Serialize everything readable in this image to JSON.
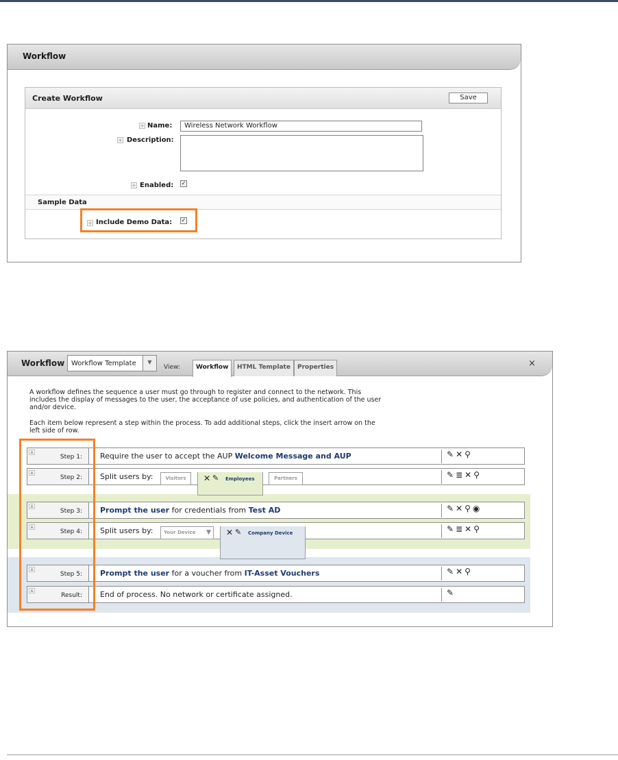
{
  "panel1": {
    "title": "Workflow",
    "form_title": "Create Workflow",
    "save_label": "Save",
    "name_label": "Name:",
    "name_value": "Wireless Network Workflow",
    "description_label": "Description:",
    "enabled_label": "Enabled:",
    "enabled_checked": true,
    "section_label": "Sample Data",
    "demo_label": "Include Demo Data:",
    "demo_checked": true,
    "highlight_color": "#f58025"
  },
  "panel2": {
    "title": "Workflow",
    "template_select": "Workflow Template",
    "view_label": "View:",
    "tabs": [
      "Workflow",
      "HTML Template",
      "Properties"
    ],
    "active_tab": "Workflow",
    "close_label": "×",
    "desc_para1_lines": [
      "A workflow defines the sequence a user must go through to register and connect to the network. This",
      "includes the display of messages to the user, the acceptance of use policies, and authentication of the user",
      "and/or device."
    ],
    "desc_para2_lines": [
      "Each item below represent a step within the process. To add additional steps, click the insert arrow on the",
      "left side of row."
    ],
    "steps": [
      {
        "label": "Step 1:",
        "pre": "Require the user to accept the AUP ",
        "bold": "Welcome Message and AUP",
        "post": "",
        "actions": [
          "edit-icon",
          "delete-icon",
          "search-icon"
        ]
      },
      {
        "label": "Step 2:",
        "pre": "Split users by:",
        "segments": [
          "Visitors",
          "Employees",
          "Partners"
        ],
        "active_segment": "Employees",
        "actions": [
          "edit-icon",
          "list-icon",
          "delete-icon",
          "search-icon"
        ]
      },
      {
        "label": "Step 3:",
        "bold1": "Prompt the user",
        "mid": " for credentials from ",
        "bold2": "Test AD",
        "actions": [
          "edit-icon",
          "delete-icon",
          "search-icon",
          "play-icon"
        ]
      },
      {
        "label": "Step 4:",
        "pre": "Split users by:",
        "segments": [
          "Your Device",
          "Company Device"
        ],
        "active_segment": "Company Device",
        "actions": [
          "edit-icon",
          "list-icon",
          "delete-icon",
          "search-icon"
        ]
      },
      {
        "label": "Step 5:",
        "bold1": "Prompt the user",
        "mid": " for a voucher from ",
        "bold2": "IT-Asset Vouchers",
        "actions": [
          "edit-icon",
          "delete-icon",
          "search-icon"
        ]
      },
      {
        "label": "Result:",
        "pre": "End of process. No network or certificate assigned.",
        "actions": [
          "edit-icon"
        ]
      }
    ],
    "green_band": "#e6efcd",
    "blue_band": "#dfe6ee"
  }
}
